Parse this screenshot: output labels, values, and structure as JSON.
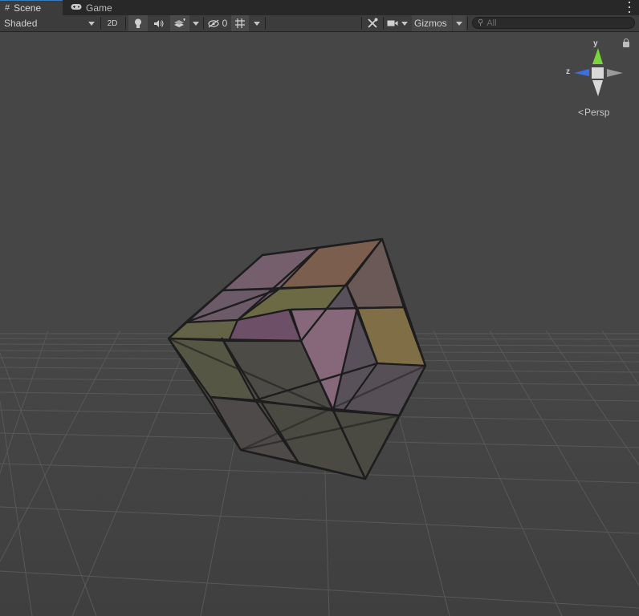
{
  "tabs": [
    {
      "label": "Scene",
      "icon": "grid-icon",
      "active": true
    },
    {
      "label": "Game",
      "icon": "gamepad-icon",
      "active": false
    }
  ],
  "toolbar": {
    "shading_mode": "Shaded",
    "mode_2d_label": "2D",
    "hidden_count": "0",
    "gizmos_label": "Gizmos",
    "search_placeholder": "All"
  },
  "orientation_gizmo": {
    "y_label": "y",
    "z_label": "z",
    "projection_label": "Persp",
    "y_color": "#7ad43c",
    "z_color": "#3d6fe0",
    "x_color": "#c8c8c8"
  },
  "scene": {
    "background": "#464646",
    "grid_color": "#5a5a5a",
    "object": "transparent-colored-cube"
  }
}
